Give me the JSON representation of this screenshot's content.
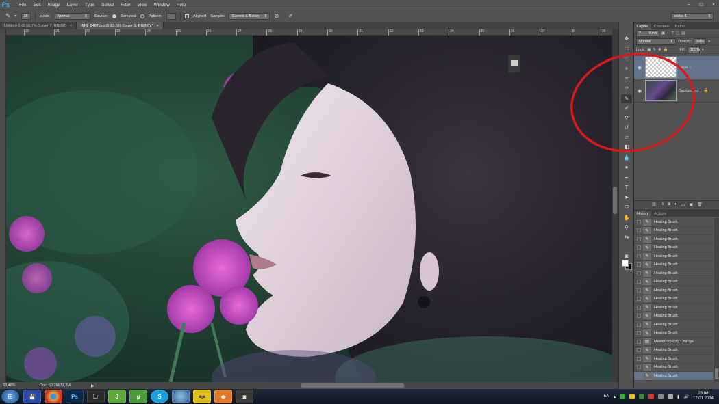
{
  "app": {
    "logo": "Ps"
  },
  "menu": [
    "File",
    "Edit",
    "Image",
    "Layer",
    "Type",
    "Select",
    "Filter",
    "View",
    "Window",
    "Help"
  ],
  "options_bar": {
    "brush_size": "25",
    "mode_label": "Mode:",
    "mode_value": "Normal",
    "source_label": "Source:",
    "sampled_label": "Sampled",
    "pattern_label": "Pattern:",
    "aligned_label": "Aligned",
    "sample_label": "Sample:",
    "sample_value": "Current & Below",
    "workspace_value": "lelshn 1"
  },
  "tabs": [
    {
      "label": "Untitled-1 @ 66,7% (Layer 7, RGB/8)",
      "close": "×"
    },
    {
      "label": "IMG_8487.jpg @ 83,5% (Layer 1, RGB/8) *",
      "close": "×"
    }
  ],
  "ruler_h": [
    "20",
    "21",
    "22",
    "23",
    "24",
    "25",
    "26",
    "27",
    "28",
    "29",
    "30",
    "31",
    "32",
    "33",
    "34",
    "35",
    "36",
    "37",
    "38",
    "39"
  ],
  "status": {
    "zoom": "83,48%",
    "doc": "Doc: 60,2M/72,2M",
    "arrow": "▶"
  },
  "layers_panel": {
    "tabs": [
      "Layers",
      "Channels",
      "Paths"
    ],
    "kind_label": "Kind",
    "blend_mode": "Normal",
    "opacity_label": "Opacity:",
    "opacity_value": "88%",
    "lock_label": "Lock:",
    "fill_label": "Fill:",
    "fill_value": "100%",
    "layers": [
      {
        "name": "Layer 1",
        "selected": true
      },
      {
        "name": "Background",
        "selected": false
      }
    ]
  },
  "history_panel": {
    "tabs": [
      "History",
      "Actions"
    ],
    "items": [
      "Healing Brush",
      "Healing Brush",
      "Healing Brush",
      "Healing Brush",
      "Healing Brush",
      "Healing Brush",
      "Healing Brush",
      "Healing Brush",
      "Healing Brush",
      "Healing Brush",
      "Healing Brush",
      "Healing Brush",
      "Healing Brush",
      "Healing Brush",
      "Master Opacity Change",
      "Healing Brush",
      "Healing Brush",
      "Healing Brush",
      "Healing Brush"
    ]
  },
  "taskbar": {
    "apps": [
      "",
      "",
      "",
      "Ps",
      "Lr",
      "J",
      "µ",
      "S",
      "",
      "",
      "",
      ""
    ],
    "lang": "EN",
    "time": "23:06",
    "date": "12.01.2014"
  },
  "colors": {
    "annotation": "#d81a1a",
    "selection": "#63738c",
    "panel": "#535353"
  }
}
